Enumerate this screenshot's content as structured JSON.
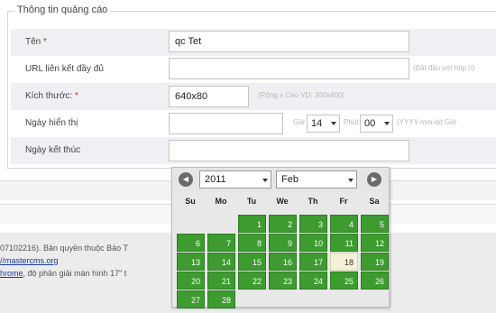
{
  "form": {
    "legend": "Thông tin quảng cáo",
    "required_mark": "*",
    "name": {
      "label": "Tên",
      "value": "qc Tet"
    },
    "url": {
      "label": "URL liên kết đầy đủ",
      "value": "",
      "hint": "(Bắt đầu với http://)"
    },
    "size": {
      "label": "Kích thước:",
      "value": "640x80",
      "hint": "(Rộng x Cao VD: 300x400)"
    },
    "start_date": {
      "label": "Ngày hiển thị",
      "value": "",
      "hour_label": "Giờ",
      "hour_value": "14",
      "minute_label": "Phút",
      "minute_value": "00",
      "hint": "(YYYY-mm-dd Giờ"
    },
    "end_date": {
      "label": "Ngày kết thúc",
      "value": ""
    }
  },
  "calendar": {
    "prev_icon": "chevron-left-icon",
    "next_icon": "chevron-right-icon",
    "year": "2011",
    "month": "Feb",
    "weekdays": [
      "Su",
      "Mo",
      "Tu",
      "We",
      "Th",
      "Fr",
      "Sa"
    ],
    "weeks": [
      [
        "",
        "",
        "1",
        "2",
        "3",
        "4",
        "5"
      ],
      [
        "6",
        "7",
        "8",
        "9",
        "10",
        "11",
        "12"
      ],
      [
        "13",
        "14",
        "15",
        "16",
        "17",
        "18",
        "19"
      ],
      [
        "20",
        "21",
        "22",
        "23",
        "24",
        "25",
        "26"
      ],
      [
        "27",
        "28",
        "",
        "",
        "",
        "",
        ""
      ]
    ],
    "highlighted_day": "18",
    "colors": {
      "day": "#3d9b2f",
      "highlight": "#f5f0d6"
    }
  },
  "footer": {
    "line1": "07102216). Bản quyền thuộc Bảo T",
    "link1": "//mastercms.org",
    "link2": "hrome",
    "line3": ", độ phân giải màn hình 17\" t"
  }
}
